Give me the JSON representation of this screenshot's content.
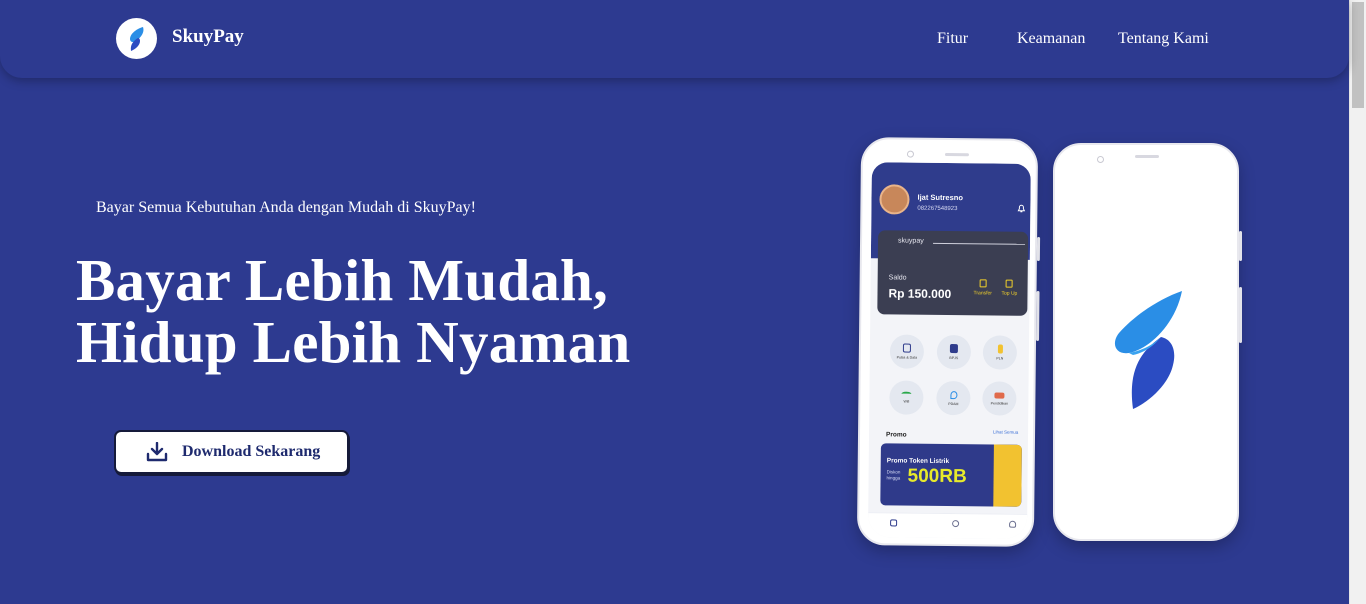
{
  "nav": {
    "brand": "SkuyPay",
    "links": [
      "Fitur",
      "Keamanan",
      "Tentang Kami"
    ]
  },
  "hero": {
    "tagline": "Bayar Semua Kebutuhan Anda dengan Mudah di SkuyPay!",
    "headline_line1": "Bayar Lebih Mudah,",
    "headline_line2": "Hidup Lebih Nyaman",
    "download_label": "Download Sekarang"
  },
  "phone_app": {
    "user_name": "Ijat Sutresno",
    "user_phone": "082267548923",
    "card_brand": "skuypay",
    "saldo_label": "Saldo",
    "saldo_value": "Rp 150.000",
    "actions": [
      "Transfer",
      "Top Up"
    ],
    "services": [
      "Pulsa & Data",
      "BPJS",
      "PLN",
      "Wifi",
      "PDAM",
      "Pendidikan"
    ],
    "promo_label": "Promo",
    "promo_see_all": "Lihat Semua",
    "banner_title": "Promo Token Listrik",
    "banner_sub1": "Diskon",
    "banner_sub2": "hingga",
    "banner_amount": "500RB"
  },
  "colors": {
    "background": "#2d3a90",
    "logo_blue": "#2a8ee6",
    "banner_yellow": "#e7ea2b"
  }
}
